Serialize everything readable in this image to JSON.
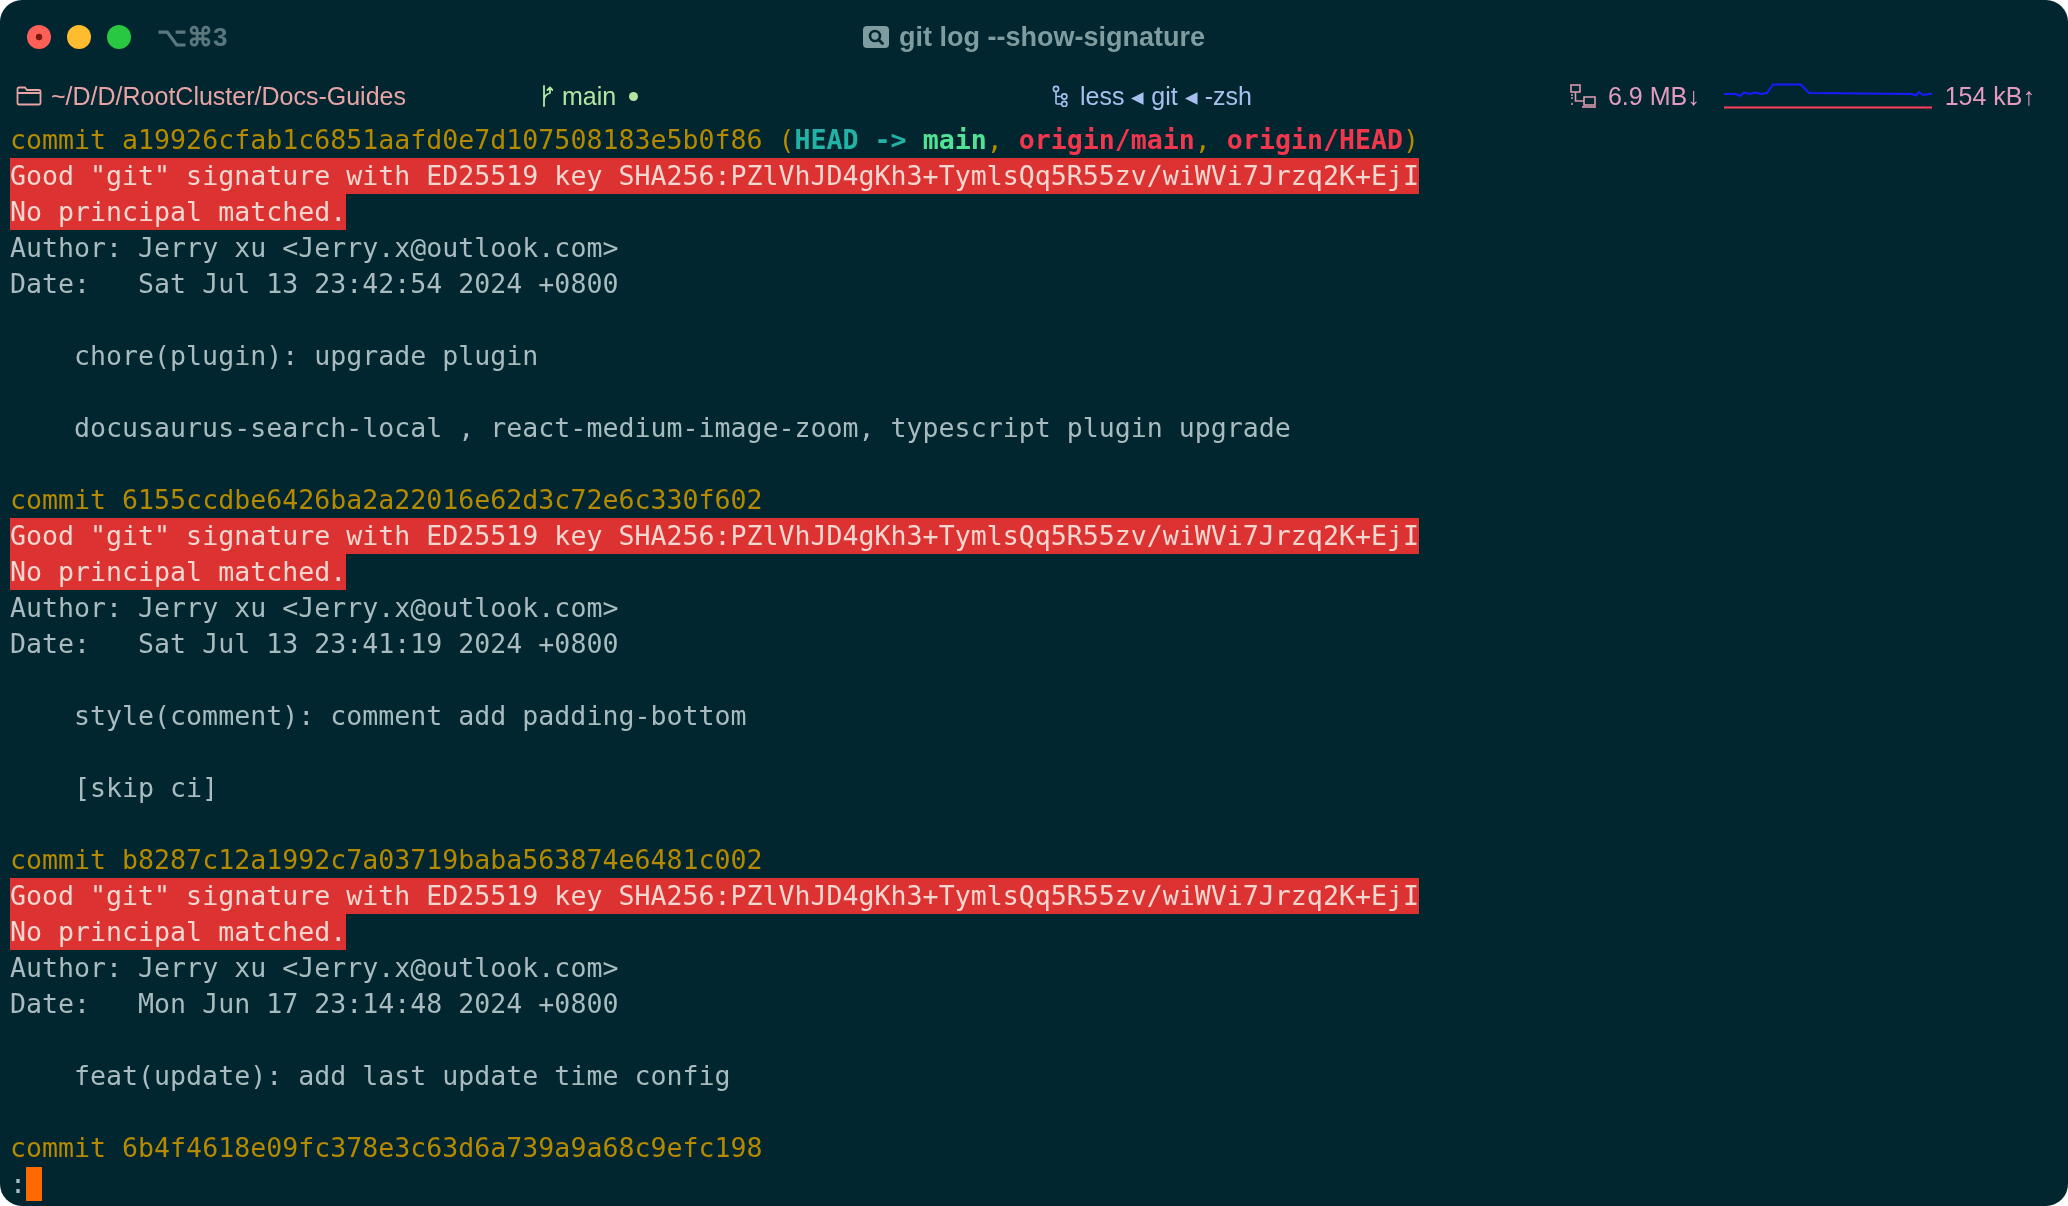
{
  "window": {
    "shortcut": "⌥⌘3",
    "title": "git log --show-signature"
  },
  "status_bar": {
    "path": "~/D/D/RootCluster/Docs-Guides",
    "branch": "main",
    "dirty": true,
    "process": "less ◂ git ◂ -zsh",
    "download": "6.9 MB↓",
    "upload": "154 kB↑"
  },
  "commits": [
    {
      "header": [
        {
          "text": "commit a19926cfab1c6851aafd0e7d107508183e5b0f86 (",
          "kind": "plain"
        },
        {
          "text": "HEAD -> ",
          "kind": "head"
        },
        {
          "text": "main",
          "kind": "local"
        },
        {
          "text": ", ",
          "kind": "plain"
        },
        {
          "text": "origin/main",
          "kind": "remote"
        },
        {
          "text": ", ",
          "kind": "plain"
        },
        {
          "text": "origin/HEAD",
          "kind": "remote"
        },
        {
          "text": ")",
          "kind": "plain"
        }
      ],
      "signature": {
        "highlighted": true,
        "lines": [
          "Good \"git\" signature with ED25519 key SHA256:PZlVhJD4gKh3+TymlsQq5R55zv/wiWVi7Jrzq2K+EjI",
          "No principal matched."
        ]
      },
      "author": "Author: Jerry xu <Jerry.x@outlook.com>",
      "date": "Date:   Sat Jul 13 23:42:54 2024 +0800",
      "message": [
        "chore(plugin): upgrade plugin",
        "docusaurus-search-local , react-medium-image-zoom, typescript plugin upgrade"
      ]
    },
    {
      "header": [
        {
          "text": "commit 6155ccdbe6426ba2a22016e62d3c72e6c330f602",
          "kind": "plain"
        }
      ],
      "signature": {
        "highlighted": true,
        "lines": [
          "Good \"git\" signature with ED25519 key SHA256:PZlVhJD4gKh3+TymlsQq5R55zv/wiWVi7Jrzq2K+EjI",
          "No principal matched."
        ]
      },
      "author": "Author: Jerry xu <Jerry.x@outlook.com>",
      "date": "Date:   Sat Jul 13 23:41:19 2024 +0800",
      "message": [
        "style(comment): comment add padding-bottom",
        "[skip ci]"
      ]
    },
    {
      "header": [
        {
          "text": "commit b8287c12a1992c7a03719baba563874e6481c002",
          "kind": "plain"
        }
      ],
      "signature": {
        "highlighted": true,
        "lines": [
          "Good \"git\" signature with ED25519 key SHA256:PZlVhJD4gKh3+TymlsQq5R55zv/wiWVi7Jrzq2K+EjI",
          "No principal matched."
        ]
      },
      "author": "Author: Jerry xu <Jerry.x@outlook.com>",
      "date": "Date:   Mon Jun 17 23:14:48 2024 +0800",
      "message": [
        "feat(update): add last update time config"
      ]
    },
    {
      "header": [
        {
          "text": "commit 6b4f4618e09fc378e3c63d6a739a9a68c9efc198",
          "kind": "plain"
        }
      ]
    }
  ],
  "pager_prompt": ":"
}
